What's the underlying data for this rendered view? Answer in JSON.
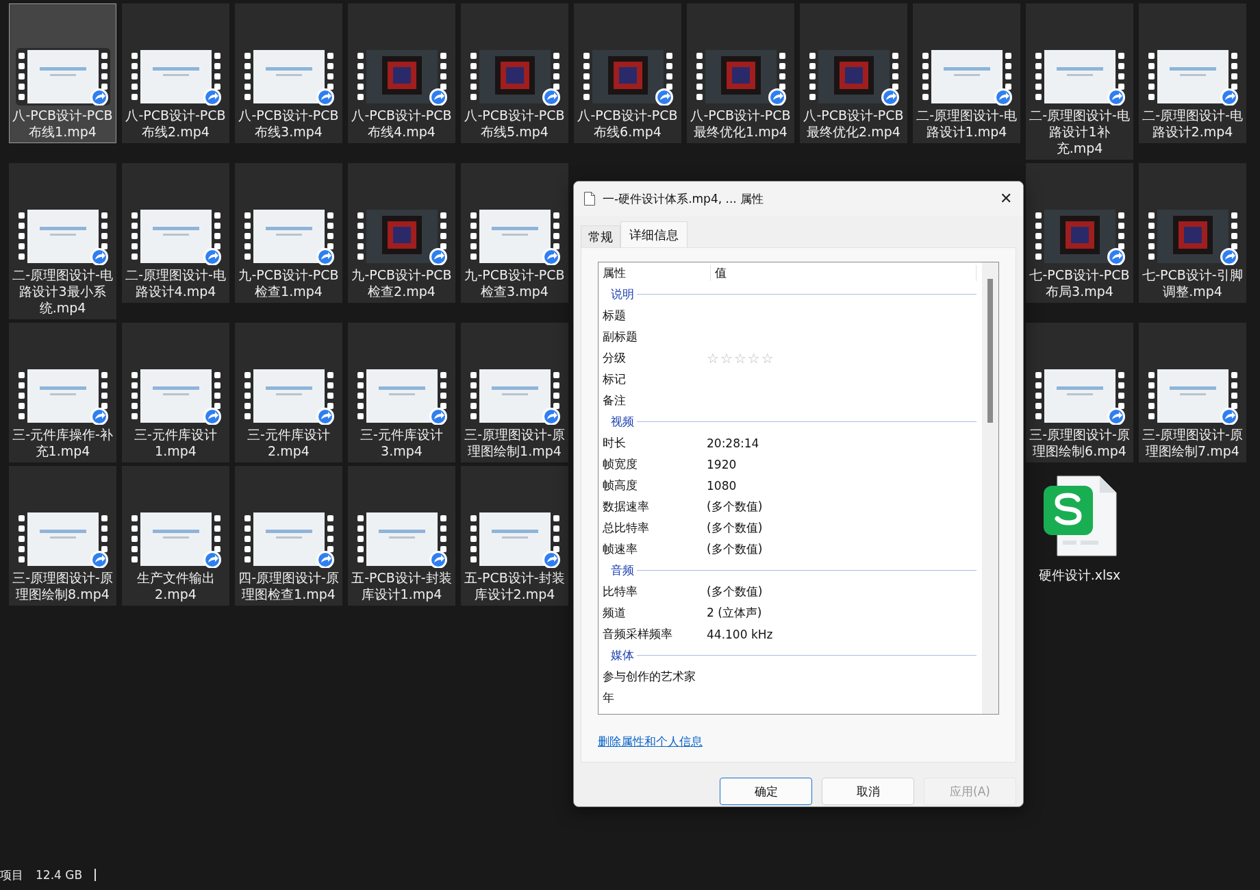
{
  "file_rows": [
    {
      "files": [
        {
          "kind": "slidevideo",
          "name": "八-PCB设计-PCB布线1.mp4",
          "selected": true
        },
        {
          "kind": "slidevideo",
          "name": "八-PCB设计-PCB布线2.mp4",
          "selected": false
        },
        {
          "kind": "slidevideo",
          "name": "八-PCB设计-PCB布线3.mp4",
          "selected": false
        },
        {
          "kind": "boardvideo",
          "name": "八-PCB设计-PCB布线4.mp4",
          "selected": false
        },
        {
          "kind": "boardvideo",
          "name": "八-PCB设计-PCB布线5.mp4",
          "selected": false
        },
        {
          "kind": "boardvideo",
          "name": "八-PCB设计-PCB布线6.mp4",
          "selected": false
        },
        {
          "kind": "boardvideo",
          "name": "八-PCB设计-PCB最终优化1.mp4",
          "selected": false
        },
        {
          "kind": "boardvideo",
          "name": "八-PCB设计-PCB最终优化2.mp4",
          "selected": false
        },
        {
          "kind": "slidevideo",
          "name": "二-原理图设计-电路设计1.mp4",
          "selected": false
        },
        {
          "kind": "slidevideo",
          "name": "二-原理图设计-电路设计1补充.mp4",
          "selected": false
        },
        {
          "kind": "slidevideo",
          "name": "二-原理图设计-电路设计2.mp4",
          "selected": false
        }
      ]
    },
    {
      "files": [
        {
          "kind": "slidevideo",
          "name": "二-原理图设计-电路设计3最小系统.mp4",
          "selected": false
        },
        {
          "kind": "slidevideo",
          "name": "二-原理图设计-电路设计4.mp4",
          "selected": false
        },
        {
          "kind": "slidevideo",
          "name": "九-PCB设计-PCB检查1.mp4",
          "selected": false
        },
        {
          "kind": "boardvideo",
          "name": "九-PCB设计-PCB检查2.mp4",
          "selected": false
        },
        {
          "kind": "slidevideo",
          "name": "九-PCB设计-PCB检查3.mp4",
          "selected": false
        },
        {
          "kind": "boardvideo",
          "name": "七-PCB设计-PCB布局3.mp4",
          "selected": false
        },
        {
          "kind": "boardvideo",
          "name": "七-PCB设计-引脚调整.mp4",
          "selected": false
        }
      ]
    },
    {
      "files": [
        {
          "kind": "slidevideo",
          "name": "三-元件库操作-补充1.mp4",
          "selected": false
        },
        {
          "kind": "slidevideo",
          "name": "三-元件库设计1.mp4",
          "selected": false
        },
        {
          "kind": "slidevideo",
          "name": "三-元件库设计2.mp4",
          "selected": false
        },
        {
          "kind": "slidevideo",
          "name": "三-元件库设计3.mp4",
          "selected": false
        },
        {
          "kind": "slidevideo",
          "name": "三-原理图设计-原理图绘制1.mp4",
          "selected": false
        },
        {
          "kind": "slidevideo",
          "name": "三-原理图设计-原理图绘制6.mp4",
          "selected": false
        },
        {
          "kind": "slidevideo",
          "name": "三-原理图设计-原理图绘制7.mp4",
          "selected": false
        }
      ]
    },
    {
      "files": [
        {
          "kind": "slidevideo",
          "name": "三-原理图设计-原理图绘制8.mp4",
          "selected": false
        },
        {
          "kind": "slidevideo",
          "name": "生产文件输出2.mp4",
          "selected": false
        },
        {
          "kind": "slidevideo",
          "name": "四-原理图设计-原理图检查1.mp4",
          "selected": false
        },
        {
          "kind": "slidevideo",
          "name": "五-PCB设计-封装库设计1.mp4",
          "selected": false
        },
        {
          "kind": "slidevideo",
          "name": "五-PCB设计-封装库设计2.mp4",
          "selected": false
        },
        {
          "kind": "spreadsheet",
          "name": "硬件设计.xlsx",
          "selected": false
        }
      ]
    }
  ],
  "status_bar": {
    "items": "项目",
    "size": "12.4 GB"
  },
  "dialog": {
    "title": "一-硬件设计体系.mp4, ... 属性",
    "close": "✕",
    "tabs": [
      {
        "label": "常规",
        "selected": false
      },
      {
        "label": "详细信息",
        "selected": true
      }
    ],
    "columns": [
      "属性",
      "值"
    ],
    "sections": [
      {
        "title": "说明",
        "rows": [
          {
            "kind": "text",
            "name": "标题"
          },
          {
            "kind": "text",
            "name": "副标题"
          },
          {
            "kind": "rating",
            "name": "分级",
            "stars": 0
          },
          {
            "kind": "text",
            "name": "标记"
          },
          {
            "kind": "text",
            "name": "备注"
          }
        ]
      },
      {
        "title": "视频",
        "rows": [
          {
            "kind": "text",
            "name": "时长",
            "value": "20:28:14"
          },
          {
            "kind": "text",
            "name": "帧宽度",
            "value": "1920"
          },
          {
            "kind": "text",
            "name": "帧高度",
            "value": "1080"
          },
          {
            "kind": "text",
            "name": "数据速率",
            "value": "(多个数值)"
          },
          {
            "kind": "text",
            "name": "总比特率",
            "value": "(多个数值)"
          },
          {
            "kind": "text",
            "name": "帧速率",
            "value": "(多个数值)"
          }
        ]
      },
      {
        "title": "音频",
        "rows": [
          {
            "kind": "text",
            "name": "比特率",
            "value": "(多个数值)"
          },
          {
            "kind": "text",
            "name": "频道",
            "value": "2 (立体声)"
          },
          {
            "kind": "text",
            "name": "音频采样频率",
            "value": "44.100 kHz"
          }
        ]
      },
      {
        "title": "媒体",
        "rows": [
          {
            "kind": "text",
            "name": "参与创作的艺术家"
          },
          {
            "kind": "text",
            "name": "年"
          }
        ]
      }
    ],
    "link": "删除属性和个人信息",
    "buttons": [
      {
        "label": "确定",
        "kind": "default",
        "disabled": false
      },
      {
        "label": "取消",
        "kind": "normal",
        "disabled": false
      },
      {
        "label": "应用(A)",
        "kind": "normal",
        "disabled": true
      }
    ]
  }
}
